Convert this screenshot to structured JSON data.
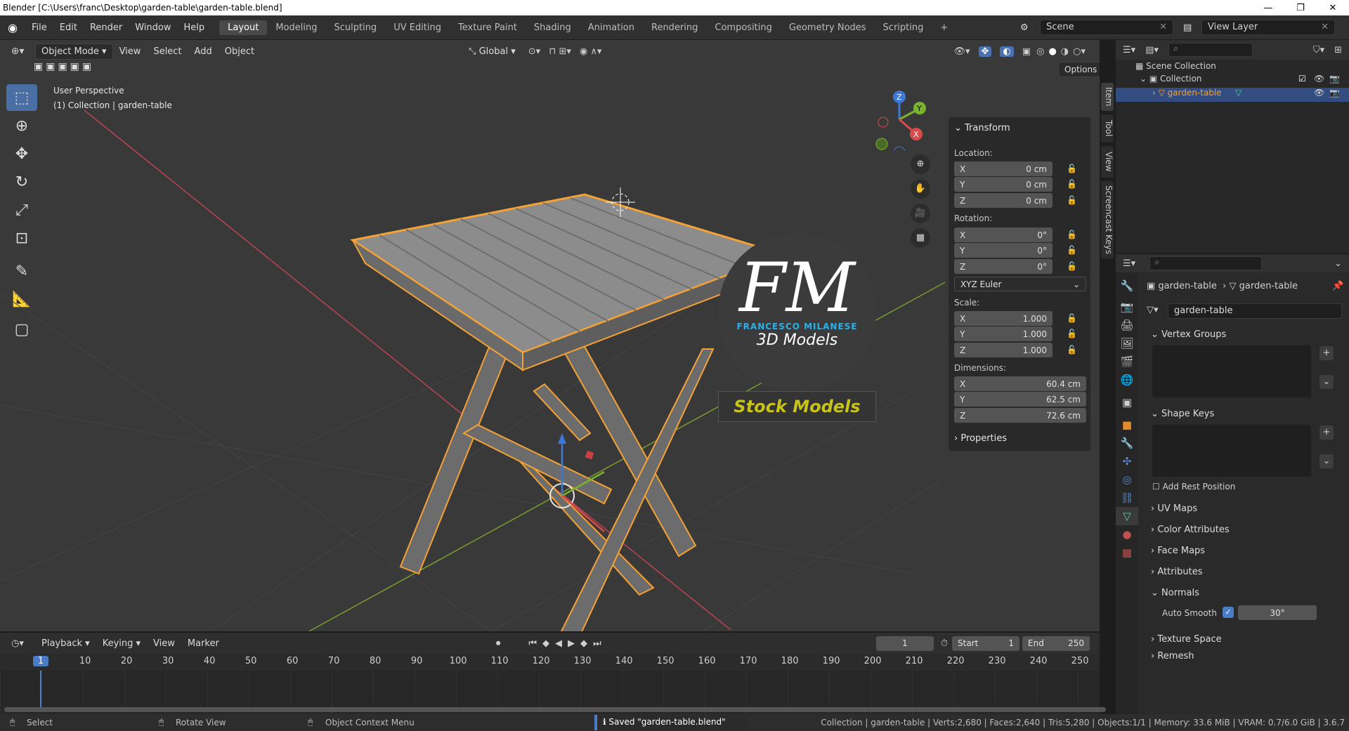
{
  "window": {
    "title": "Blender [C:\\Users\\franc\\Desktop\\garden-table\\garden-table.blend]",
    "minimize": "—",
    "maximize": "❐",
    "close": "✕"
  },
  "menus": [
    "File",
    "Edit",
    "Render",
    "Window",
    "Help"
  ],
  "workspaces": [
    "Layout",
    "Modeling",
    "Sculpting",
    "UV Editing",
    "Texture Paint",
    "Shading",
    "Animation",
    "Rendering",
    "Compositing",
    "Geometry Nodes",
    "Scripting"
  ],
  "workspace_add": "+",
  "scene": "Scene",
  "view_layer": "View Layer",
  "viewport": {
    "mode": "Object Mode",
    "menus": [
      "View",
      "Select",
      "Add",
      "Object"
    ],
    "orientation": "Global",
    "options": "Options",
    "info_line1": "User Perspective",
    "info_line2": "(1) Collection | garden-table",
    "gizmo": {
      "x": "X",
      "y": "Y",
      "z": "Z"
    }
  },
  "npanel": {
    "header": "Transform",
    "location_label": "Location:",
    "location": [
      {
        "axis": "X",
        "value": "0 cm"
      },
      {
        "axis": "Y",
        "value": "0 cm"
      },
      {
        "axis": "Z",
        "value": "0 cm"
      }
    ],
    "rotation_label": "Rotation:",
    "rotation": [
      {
        "axis": "X",
        "value": "0°"
      },
      {
        "axis": "Y",
        "value": "0°"
      },
      {
        "axis": "Z",
        "value": "0°"
      }
    ],
    "rotation_mode": "XYZ Euler",
    "scale_label": "Scale:",
    "scale": [
      {
        "axis": "X",
        "value": "1.000"
      },
      {
        "axis": "Y",
        "value": "1.000"
      },
      {
        "axis": "Z",
        "value": "1.000"
      }
    ],
    "dimensions_label": "Dimensions:",
    "dimensions": [
      {
        "axis": "X",
        "value": "60.4 cm"
      },
      {
        "axis": "Y",
        "value": "62.5 cm"
      },
      {
        "axis": "Z",
        "value": "72.6 cm"
      }
    ],
    "properties": "Properties",
    "tabs": [
      "Item",
      "Tool",
      "View",
      "Screencast Keys"
    ]
  },
  "watermark": {
    "logo": "FM",
    "name": "FRANCESCO MILANESE",
    "sub": "3D Models",
    "banner": "Stock Models"
  },
  "outliner": {
    "scene_collection": "Scene Collection",
    "collection": "Collection",
    "object": "garden-table"
  },
  "properties": {
    "breadcrumb_object": "garden-table",
    "breadcrumb_mesh": "garden-table",
    "mesh_name": "garden-table",
    "sections": {
      "vertex_groups": "Vertex Groups",
      "shape_keys": "Shape Keys",
      "add_rest_position": "Add Rest Position",
      "uv_maps": "UV Maps",
      "color_attributes": "Color Attributes",
      "face_maps": "Face Maps",
      "attributes": "Attributes",
      "normals": "Normals",
      "auto_smooth": "Auto Smooth",
      "auto_smooth_angle": "30°",
      "texture_space": "Texture Space",
      "remesh": "Remesh"
    }
  },
  "timeline": {
    "menus": [
      "Playback",
      "Keying",
      "View",
      "Marker"
    ],
    "current_frame": "1",
    "start_label": "Start",
    "start": "1",
    "end_label": "End",
    "end": "250",
    "ticks": [
      "1",
      "10",
      "20",
      "30",
      "40",
      "50",
      "60",
      "70",
      "80",
      "90",
      "100",
      "110",
      "120",
      "130",
      "140",
      "150",
      "160",
      "170",
      "180",
      "190",
      "200",
      "210",
      "220",
      "230",
      "240",
      "250"
    ]
  },
  "status": {
    "select": "Select",
    "rotate": "Rotate View",
    "context": "Object Context Menu",
    "saved": "Saved \"garden-table.blend\"",
    "stats": "Collection | garden-table | Verts:2,680 | Faces:2,640 | Tris:5,280 | Objects:1/1 | Memory: 33.6 MiB | VRAM: 0.7/6.0 GiB | 3.6.7"
  },
  "colors": {
    "selection": "#f4a236",
    "accent": "#4a8ad6",
    "watermark_blue": "#2bb0e8",
    "watermark_yellow": "#c8c41a"
  }
}
